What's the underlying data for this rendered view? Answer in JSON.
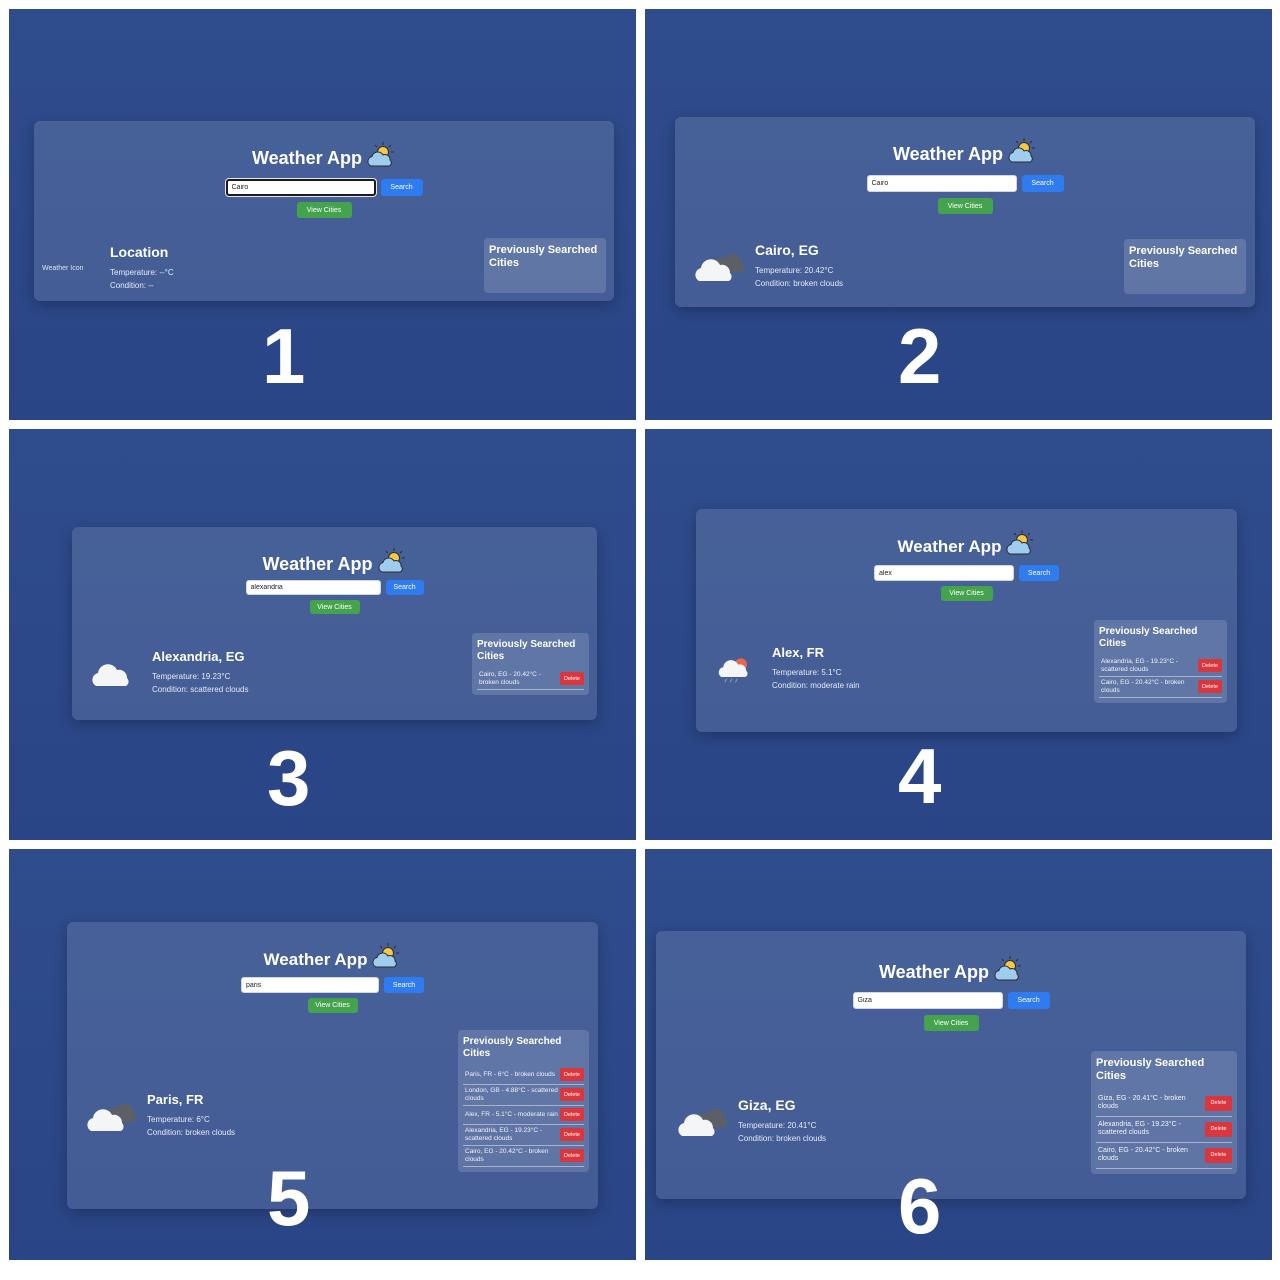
{
  "panels": [
    {
      "step": "1",
      "app_title": "Weather App",
      "search_value": "Cairo",
      "search_label": "Search",
      "view_cities_label": "View Cities",
      "weather_icon_alt": "Weather Icon",
      "location": "Location",
      "temperature": "Temperature: --°C",
      "condition": "Condition: --",
      "history_title": "Previously Searched Cities",
      "history": []
    },
    {
      "step": "2",
      "app_title": "Weather App",
      "search_value": "Cairo",
      "search_label": "Search",
      "view_cities_label": "View Cities",
      "location": "Cairo, EG",
      "temperature": "Temperature: 20.42°C",
      "condition": "Condition: broken clouds",
      "history_title": "Previously Searched Cities",
      "history": []
    },
    {
      "step": "3",
      "app_title": "Weather App",
      "search_value": "alexandria",
      "search_label": "Search",
      "view_cities_label": "View Cities",
      "location": "Alexandria, EG",
      "temperature": "Temperature: 19.23°C",
      "condition": "Condition: scattered clouds",
      "history_title": "Previously Searched Cities",
      "history": [
        {
          "text": "Cairo, EG - 20.42°C - broken clouds",
          "delete_label": "Delete"
        }
      ]
    },
    {
      "step": "4",
      "app_title": "Weather App",
      "search_value": "alex",
      "search_label": "Search",
      "view_cities_label": "View Cities",
      "location": "Alex, FR",
      "temperature": "Temperature: 5.1°C",
      "condition": "Condition: moderate rain",
      "history_title": "Previously Searched Cities",
      "history": [
        {
          "text": "Alexandria, EG - 19.23°C - scattered clouds",
          "delete_label": "Delete"
        },
        {
          "text": "Cairo, EG - 20.42°C - broken clouds",
          "delete_label": "Delete"
        }
      ]
    },
    {
      "step": "5",
      "app_title": "Weather App",
      "search_value": "paris",
      "search_label": "Search",
      "view_cities_label": "View Cities",
      "location": "Paris, FR",
      "temperature": "Temperature: 6°C",
      "condition": "Condition: broken clouds",
      "history_title": "Previously Searched Cities",
      "history": [
        {
          "text": "Paris, FR - 6°C - broken clouds",
          "delete_label": "Delete"
        },
        {
          "text": "London, GB - 4.88°C - scattered clouds",
          "delete_label": "Delete"
        },
        {
          "text": "Alex, FR - 5.1°C - moderate rain",
          "delete_label": "Delete"
        },
        {
          "text": "Alexandria, EG - 19.23°C - scattered clouds",
          "delete_label": "Delete"
        },
        {
          "text": "Cairo, EG - 20.42°C - broken clouds",
          "delete_label": "Delete"
        }
      ]
    },
    {
      "step": "6",
      "app_title": "Weather App",
      "search_value": "Giza",
      "search_label": "Search",
      "view_cities_label": "View Cities",
      "location": "Giza, EG",
      "temperature": "Temperature: 20.41°C",
      "condition": "Condition: broken clouds",
      "history_title": "Previously Searched Cities",
      "history": [
        {
          "text": "Giza, EG - 20.41°C - broken clouds",
          "delete_label": "Delete"
        },
        {
          "text": "Alexandria, EG - 19.23°C - scattered clouds",
          "delete_label": "Delete"
        },
        {
          "text": "Cairo, EG - 20.42°C - broken clouds",
          "delete_label": "Delete"
        }
      ]
    }
  ]
}
